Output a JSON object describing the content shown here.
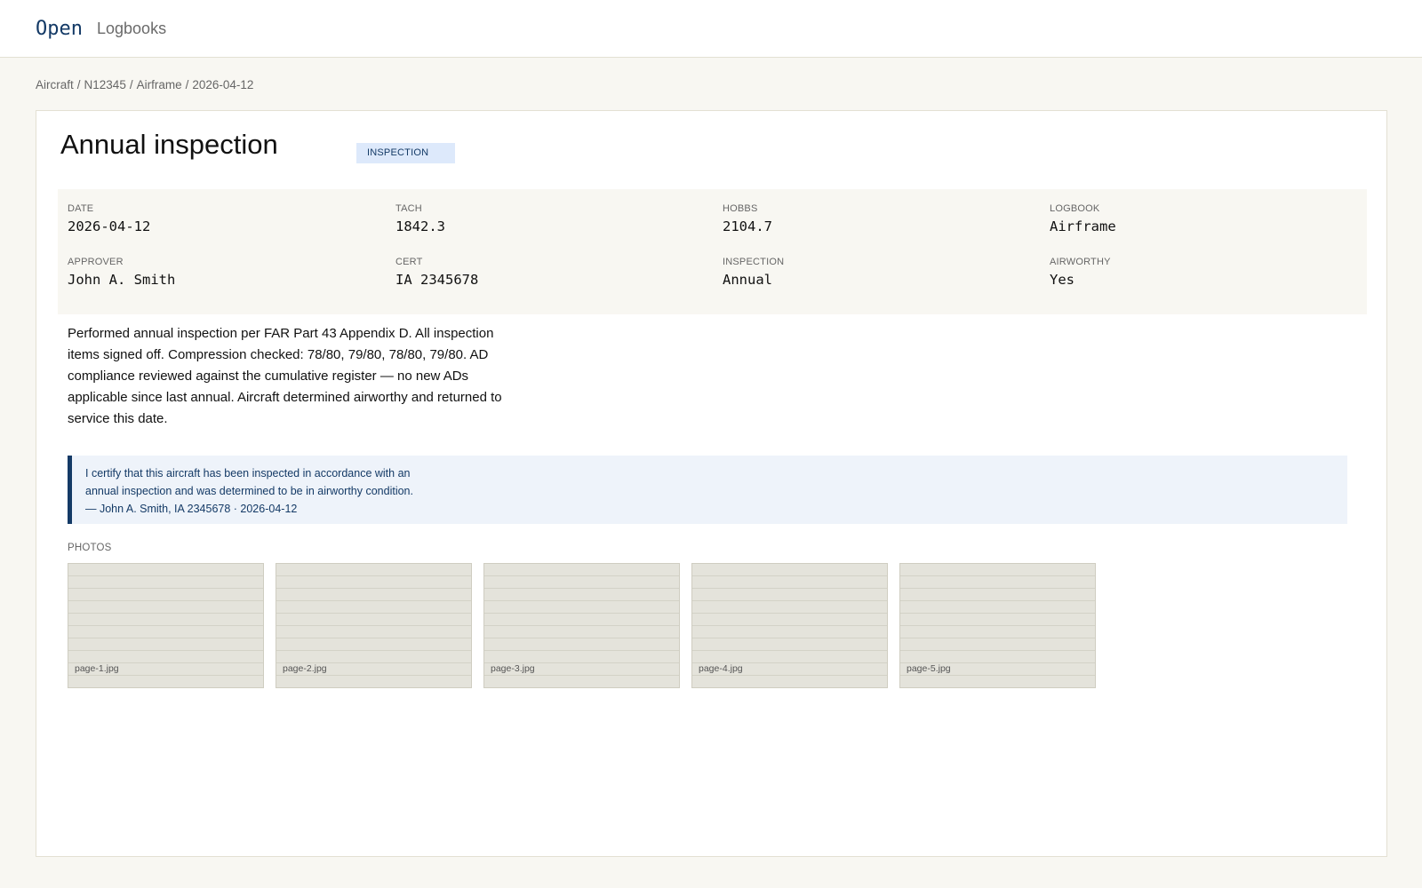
{
  "nav": {
    "brand": "Open",
    "link": "Logbooks"
  },
  "breadcrumb": [
    "Aircraft",
    "N12345",
    "Airframe",
    "2026-04-12"
  ],
  "entry": {
    "title": "Annual inspection",
    "type_badge": "INSPECTION",
    "meta": [
      {
        "label": "DATE",
        "value": "2026-04-12"
      },
      {
        "label": "TACH",
        "value": "1842.3"
      },
      {
        "label": "HOBBS",
        "value": "2104.7"
      },
      {
        "label": "LOGBOOK",
        "value": "Airframe"
      },
      {
        "label": "APPROVER",
        "value": "John A. Smith"
      },
      {
        "label": "CERT",
        "value": "IA 2345678"
      },
      {
        "label": "INSPECTION",
        "value": "Annual"
      },
      {
        "label": "AIRWORTHY",
        "value": "Yes"
      }
    ],
    "notes": "Performed annual inspection per FAR Part 43 Appendix D. All inspection items signed off. Compression checked: 78/80, 79/80, 78/80, 79/80. AD compliance reviewed against the cumulative register — no new ADs applicable since last annual. Aircraft determined airworthy and returned to service this date.",
    "certification": {
      "statement_line1": "I certify that this aircraft has been inspected in accordance with an",
      "statement_line2": "annual inspection and was determined to be in airworthy condition.",
      "signature": "— John A. Smith, IA 2345678 · 2026-04-12"
    },
    "photos_label": "PHOTOS",
    "photos": [
      "page-1.jpg",
      "page-2.jpg",
      "page-3.jpg",
      "page-4.jpg",
      "page-5.jpg"
    ]
  },
  "colors": {
    "accent": "#143a66",
    "badge_bg": "#dde9fb",
    "page_bg": "#f8f7f2",
    "cert_bg": "#eef3fa"
  }
}
